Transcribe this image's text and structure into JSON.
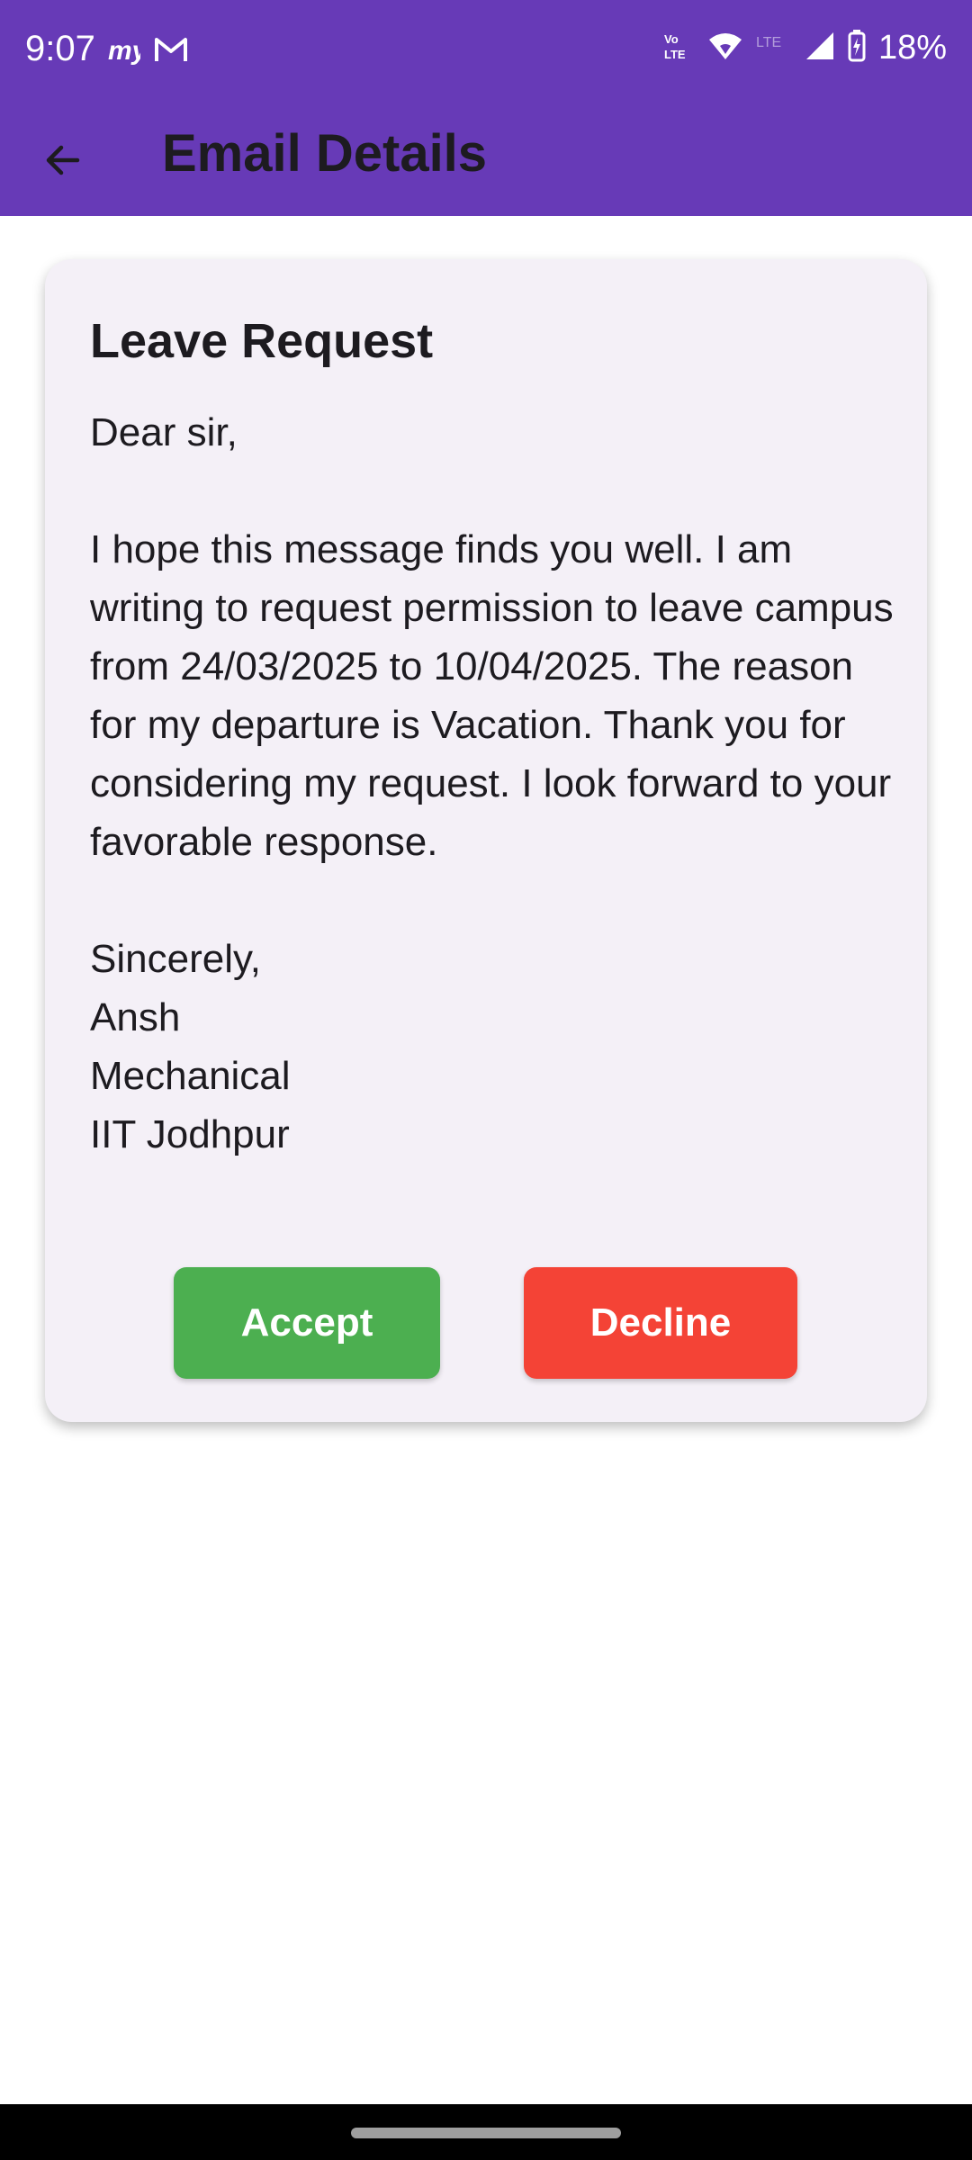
{
  "status_bar": {
    "time": "9:07",
    "battery": "18%",
    "network_label": "LTE",
    "volte_label": "Vo LTE",
    "left_icons": [
      "myjio-icon",
      "gmail-icon"
    ],
    "right_icons": [
      "volte-icon",
      "wifi-icon",
      "signal-icon",
      "battery-charging-icon"
    ]
  },
  "app_bar": {
    "title": "Email Details",
    "back_icon": "arrow-back-icon",
    "color": "#673ab7"
  },
  "email": {
    "subject": "Leave Request",
    "greeting": "Dear sir,",
    "paragraph": "I hope this message finds you well. I am writing to request permission to leave campus from 24/03/2025 to 10/04/2025. The reason for my departure is Vacation. Thank you for considering my request. I look forward to your favorable response.",
    "closing": "Sincerely,",
    "name": "Ansh",
    "department": "Mechanical",
    "institute": "IIT Jodhpur"
  },
  "actions": {
    "accept_label": "Accept",
    "decline_label": "Decline",
    "accept_color": "#4caf50",
    "decline_color": "#f44336"
  }
}
